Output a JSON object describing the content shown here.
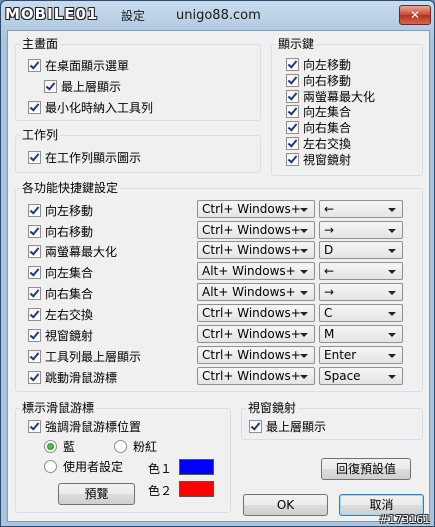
{
  "titlebar": {
    "logo_text": "MOBILE01",
    "logo_suffix": "設定",
    "title": "unigo88.com",
    "close_symbol": "✕"
  },
  "main_window": {
    "title": "主畫面",
    "show_tray": "在桌面顯示選單",
    "topmost": "最上層顯示",
    "minimize_tray": "最小化時納入工具列"
  },
  "taskbar": {
    "title": "工作列",
    "show_icon": "在工作列顯示圖示"
  },
  "display_keys": {
    "title": "顯示鍵",
    "items": [
      "向左移動",
      "向右移動",
      "兩螢幕最大化",
      "向左集合",
      "向右集合",
      "左右交換",
      "視窗鏡射"
    ]
  },
  "hotkeys": {
    "title": "各功能快捷鍵設定",
    "rows": [
      {
        "label": "向左移動",
        "mod": "Ctrl+ Windows+",
        "key": "←"
      },
      {
        "label": "向右移動",
        "mod": "Ctrl+ Windows+",
        "key": "→"
      },
      {
        "label": "兩螢幕最大化",
        "mod": "Ctrl+ Windows+",
        "key": "D"
      },
      {
        "label": "向左集合",
        "mod": "Alt+ Windows+",
        "key": "←"
      },
      {
        "label": "向右集合",
        "mod": "Alt+ Windows+",
        "key": "→"
      },
      {
        "label": "左右交換",
        "mod": "Ctrl+ Windows+",
        "key": "C"
      },
      {
        "label": "視窗鏡射",
        "mod": "Ctrl+ Windows+",
        "key": "M"
      },
      {
        "label": "工具列最上層顯示",
        "mod": "Ctrl+ Windows+",
        "key": "Enter"
      },
      {
        "label": "跳動滑鼠游標",
        "mod": "Ctrl+ Windows+",
        "key": "Space"
      }
    ]
  },
  "cursor_group": {
    "title": "標示滑鼠游標",
    "emphasize": "強調滑鼠游標位置",
    "radio_blue": "藍",
    "radio_pink": "粉紅",
    "radio_custom": "使用者設定",
    "color1_label": "色１",
    "color2_label": "色２",
    "color1": "#0000ff",
    "color2": "#ff0000",
    "preview_button": "預覽"
  },
  "mirror_group": {
    "title": "視窗鏡射",
    "topmost": "最上層顯示"
  },
  "buttons": {
    "reset": "回復預設值",
    "ok": "OK",
    "cancel": "取消"
  },
  "watermark": "#173161"
}
